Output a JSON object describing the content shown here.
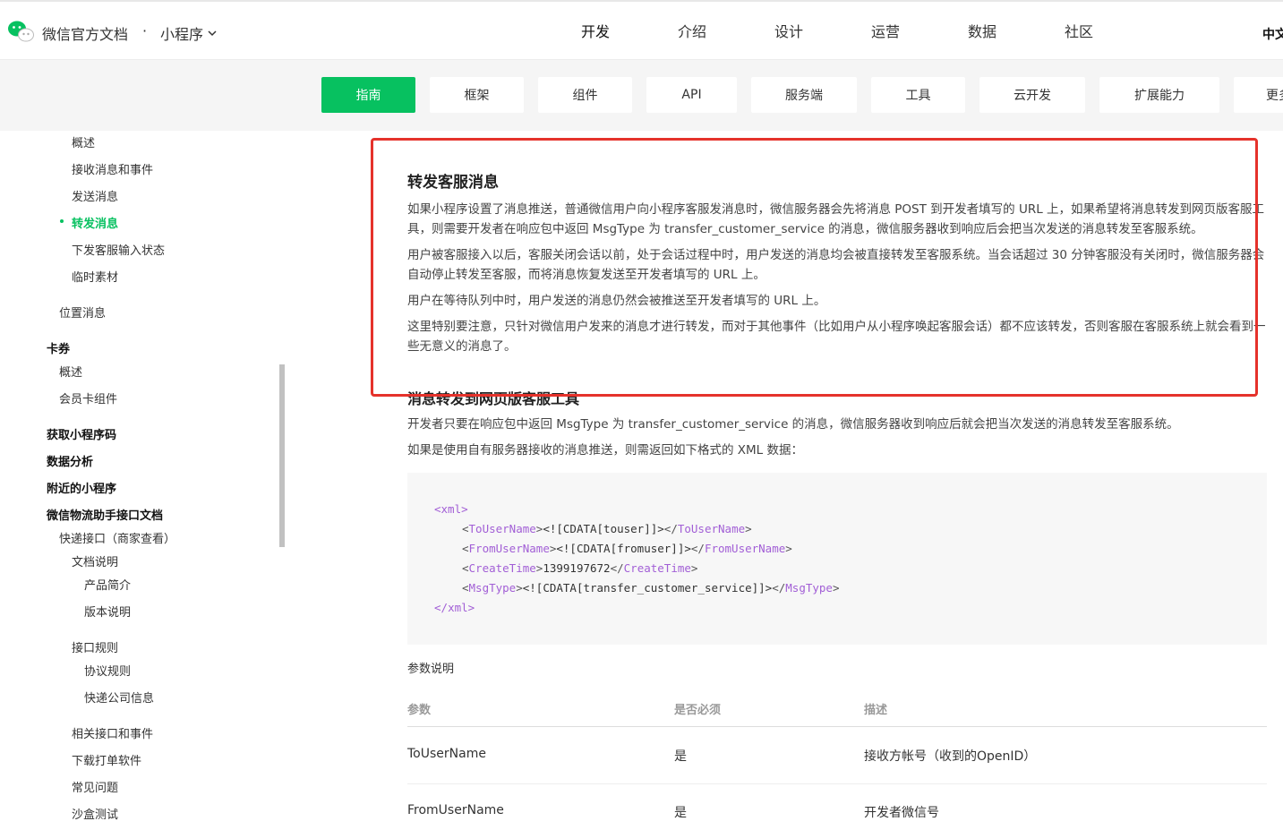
{
  "header": {
    "brand": "微信官方文档",
    "dot": "·",
    "product": "小程序",
    "nav": [
      "开发",
      "介绍",
      "设计",
      "运营",
      "数据",
      "社区"
    ],
    "active_nav": "开发",
    "lang": "中文"
  },
  "subtabs": [
    "指南",
    "框架",
    "组件",
    "API",
    "服务端",
    "工具",
    "云开发",
    "扩展能力",
    "更多"
  ],
  "sidebar": {
    "items": [
      {
        "label": "概述"
      },
      {
        "label": "接收消息和事件"
      },
      {
        "label": "发送消息"
      },
      {
        "label": "转发消息"
      },
      {
        "label": "下发客服输入状态"
      },
      {
        "label": "临时素材"
      },
      {
        "label": "位置消息"
      },
      {
        "label": "卡券"
      },
      {
        "label": "概述"
      },
      {
        "label": "会员卡组件"
      },
      {
        "label": "获取小程序码"
      },
      {
        "label": "数据分析"
      },
      {
        "label": "附近的小程序"
      },
      {
        "label": "微信物流助手接口文档"
      },
      {
        "label": "快递接口（商家查看）"
      },
      {
        "label": "文档说明"
      },
      {
        "label": "产品简介"
      },
      {
        "label": "版本说明"
      },
      {
        "label": "接口规则"
      },
      {
        "label": "协议规则"
      },
      {
        "label": "快递公司信息"
      },
      {
        "label": "相关接口和事件"
      },
      {
        "label": "下载打单软件"
      },
      {
        "label": "常见问题"
      },
      {
        "label": "沙盒测试"
      }
    ]
  },
  "content": {
    "title1": "转发客服消息",
    "p1": "如果小程序设置了消息推送，普通微信用户向小程序客服发消息时，微信服务器会先将消息 POST 到开发者填写的 URL 上，如果希望将消息转发到网页版客服工具，则需要开发者在响应包中返回 MsgType 为 transfer_customer_service 的消息，微信服务器收到响应后会把当次发送的消息转发至客服系统。",
    "p2": "用户被客服接入以后，客服关闭会话以前，处于会话过程中时，用户发送的消息均会被直接转发至客服系统。当会话超过 30 分钟客服没有关闭时，微信服务器会自动停止转发至客服，而将消息恢复发送至开发者填写的 URL 上。",
    "p3": "用户在等待队列中时，用户发送的消息仍然会被推送至开发者填写的 URL 上。",
    "p4": "这里特别要注意，只针对微信用户发来的消息才进行转发，而对于其他事件（比如用户从小程序唤起客服会话）都不应该转发，否则客服在客服系统上就会看到一些无意义的消息了。",
    "title2": "消息转发到网页版客服工具",
    "p5": "开发者只要在响应包中返回 MsgType 为 transfer_customer_service 的消息，微信服务器收到响应后就会把当次发送的消息转发至客服系统。",
    "p6": "如果是使用自有服务器接收的消息推送，则需返回如下格式的 XML 数据：",
    "code": {
      "xml_open": "xml",
      "lines": [
        {
          "tag": "ToUserName",
          "value": "<![CDATA[touser]]>"
        },
        {
          "tag": "FromUserName",
          "value": "<![CDATA[fromuser]]>"
        },
        {
          "tag": "CreateTime",
          "value": "1399197672"
        },
        {
          "tag": "MsgType",
          "value": "<![CDATA[transfer_customer_service]]>"
        }
      ],
      "xml_close": "xml"
    },
    "table_caption": "参数说明",
    "table_headers": [
      "参数",
      "是否必须",
      "描述"
    ],
    "table_rows": [
      [
        "ToUserName",
        "是",
        "接收方帐号（收到的OpenID）"
      ],
      [
        "FromUserName",
        "是",
        "开发者微信号"
      ]
    ]
  },
  "colors": {
    "accent": "#07c160",
    "highlight_box": "#e5322b",
    "code_tag": "#a25fd6"
  }
}
